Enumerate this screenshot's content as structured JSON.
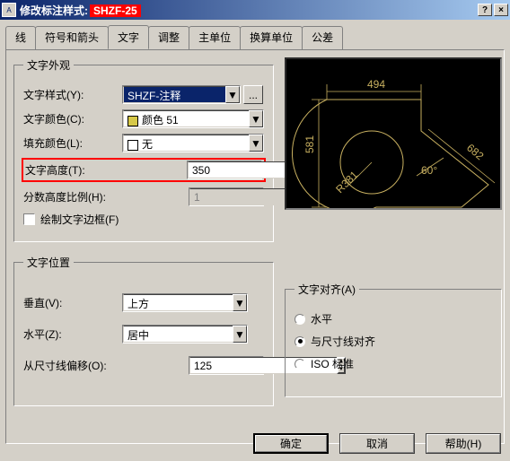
{
  "window": {
    "title_prefix": "修改标注样式:",
    "title_highlight": "SHZF-25",
    "help_btn": "?",
    "close_btn": "×"
  },
  "tabs": {
    "t0": "线",
    "t1": "符号和箭头",
    "t2": "文字",
    "t3": "调整",
    "t4": "主单位",
    "t5": "换算单位",
    "t6": "公差"
  },
  "appearance": {
    "legend": "文字外观",
    "style_label": "文字样式(Y):",
    "style_value": "SHZF-注释",
    "color_label": "文字颜色(C):",
    "color_value": "颜色 51",
    "color_swatch": "#d6c848",
    "fill_label": "填充颜色(L):",
    "fill_value": "无",
    "fill_swatch": "#ffffff",
    "height_label": "文字高度(T):",
    "height_value": "350",
    "fraction_label": "分数高度比例(H):",
    "fraction_value": "1",
    "frame_label": "绘制文字边框(F)"
  },
  "position": {
    "legend": "文字位置",
    "vert_label": "垂直(V):",
    "vert_value": "上方",
    "horiz_label": "水平(Z):",
    "horiz_value": "居中",
    "offset_label": "从尺寸线偏移(O):",
    "offset_value": "125"
  },
  "align": {
    "legend": "文字对齐(A)",
    "opt1": "水平",
    "opt2": "与尺寸线对齐",
    "opt3": "ISO 标准",
    "selected": 2
  },
  "preview": {
    "dim_top": "494",
    "dim_left": "581",
    "dim_right": "682",
    "dim_angle": "60°",
    "dim_radius": "R381"
  },
  "buttons": {
    "ok": "确定",
    "cancel": "取消",
    "help": "帮助(H)"
  }
}
